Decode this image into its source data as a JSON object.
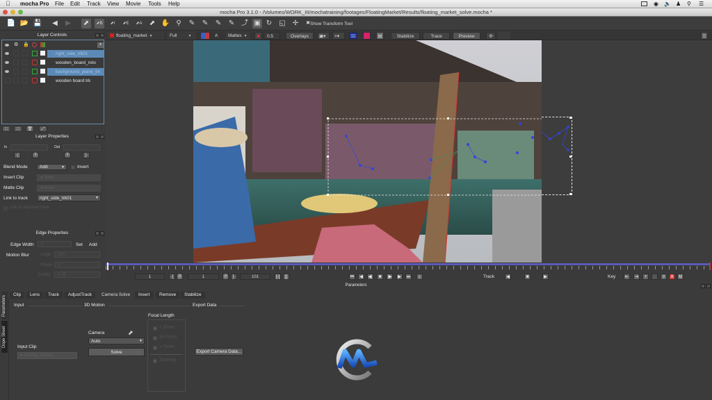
{
  "menubar": {
    "app_name": "mocha Pro",
    "items": [
      "File",
      "Edit",
      "Track",
      "View",
      "Movie",
      "Tools",
      "Help"
    ]
  },
  "window": {
    "title": "mocha Pro 3.1.0 - /Volumes/WORK_III/mochatraining/footages/FloatingMarket/Results/floating_market_solve.mocha *"
  },
  "toolbar": {
    "show_transform_label": "Show Transform Tool",
    "tools": [
      "new-file",
      "open-file",
      "save",
      "undo",
      "redo",
      "select",
      "select-bezier-b",
      "select-i",
      "select-e",
      "select-a",
      "select-point",
      "hand",
      "zoom",
      "add-x-spline",
      "add-spline",
      "add-bezier",
      "add-bezier-plus",
      "surface-tool",
      "track-tool",
      "rotate",
      "scale",
      "move"
    ]
  },
  "viewbar": {
    "clip": "floating_market",
    "resolution": "Full",
    "mattes_label": "Mattes",
    "opacity": "0.5",
    "overlays_label": "Overlays",
    "stabilize_label": "Stabilize",
    "trace_label": "Trace",
    "preview_label": "Preview",
    "clip_color": "#cc2222",
    "magenta_swatch": "#d6246a"
  },
  "layer_controls": {
    "title": "Layer Controls",
    "layers": [
      {
        "name": "right_side_trk01",
        "color": "#2fae3a",
        "visible": true,
        "selected": true
      },
      {
        "name": "wooden_board_roto",
        "color": "#d03030",
        "visible": true,
        "selected": false
      },
      {
        "name": "background_plane_trk",
        "color": "#2fae3a",
        "visible": true,
        "selected": true
      },
      {
        "name": "wooden board trk",
        "color": "#d03030",
        "visible": false,
        "selected": false
      }
    ]
  },
  "layer_properties": {
    "title": "Layer Properties",
    "in_label": "In",
    "out_label": "Out",
    "blend_mode_label": "Blend Mode",
    "blend_mode_value": "Add",
    "invert_label": "Invert",
    "insert_clip_label": "Insert Clip",
    "insert_clip_value": "None",
    "matte_clip_label": "Matte Clip",
    "matte_clip_value": "None",
    "link_to_track_label": "Link to track",
    "link_to_track_value": "right_side_trk01",
    "link_adjusted_label": "Link to adjusted track"
  },
  "edge_properties": {
    "title": "Edge Properties",
    "edge_width_label": "Edge Width",
    "edge_width_value": "0",
    "set_label": "Set",
    "add_label": "Add",
    "motion_blur_label": "Motion Blur",
    "angle_label": "Angle",
    "angle_value": "180",
    "phase_label": "Phase",
    "phase_value": "0",
    "quality_label": "Quality",
    "quality_value": "0.25"
  },
  "timeline": {
    "in_frame": "1",
    "current_frame": "1",
    "out_frame": "101",
    "track_label": "Track",
    "key_label": "Key",
    "parameters_label": "Parameters",
    "playhead_fraction": 0.0
  },
  "parameters": {
    "side_tabs": [
      "Parameters",
      "Dope Sheet"
    ],
    "tabs": [
      "Clip",
      "Lens",
      "Track",
      "AdjustTrack",
      "Camera Solve",
      "Insert",
      "Remove",
      "Stabilize"
    ],
    "active_tab": "Camera Solve",
    "input_header": "Input",
    "motion_header": "3D Motion",
    "export_header": "Export Data",
    "input_clip_label": "Input Clip",
    "input_clip_value": "floating_market",
    "camera_label": "Camera",
    "camera_value": "Auto",
    "solve_label": "Solve",
    "focal_length_label": "Focal Length",
    "focal_options": [
      "< 35mm",
      "35-70mm",
      "> 70mm"
    ],
    "zooming_label": "Zooming",
    "export_camera_label": "Export Camera Data..."
  }
}
